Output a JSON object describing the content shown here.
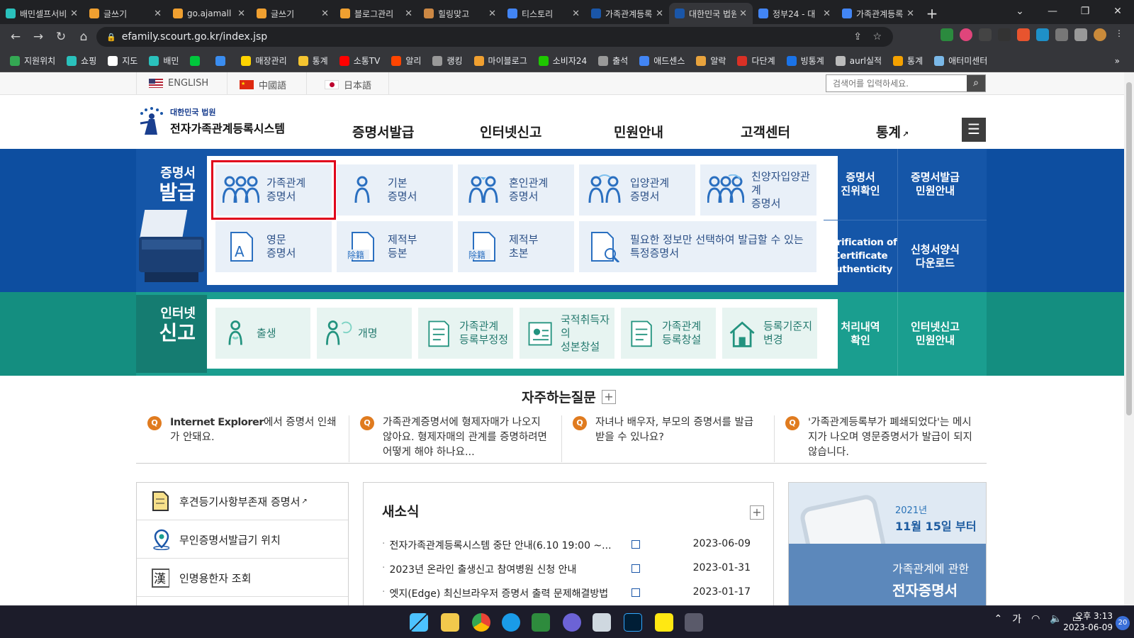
{
  "browser": {
    "tabs": [
      {
        "title": "배민셀프서비스",
        "color": "#2ac1bc"
      },
      {
        "title": "글쓰기",
        "color": "#f0a030"
      },
      {
        "title": "go.ajamall",
        "color": "#f0a030"
      },
      {
        "title": "글쓰기",
        "color": "#f0a030"
      },
      {
        "title": "블로그관리",
        "color": "#f0a030"
      },
      {
        "title": "힐링맞고",
        "color": "#cc8844"
      },
      {
        "title": "티스토리",
        "color": "#4285f4"
      },
      {
        "title": "가족관계등록",
        "color": "#1a56a8"
      },
      {
        "title": "대한민국 법원",
        "color": "#1a56a8",
        "active": true
      },
      {
        "title": "정부24 - 대",
        "color": "#4285f4"
      },
      {
        "title": "가족관계등록",
        "color": "#4285f4"
      }
    ],
    "url": "efamily.scourt.go.kr/index.jsp",
    "bookmarks": [
      {
        "label": "지원위치",
        "color": "#34a853"
      },
      {
        "label": "쇼핑",
        "color": "#2ac1bc"
      },
      {
        "label": "지도",
        "color": "#ffffff"
      },
      {
        "label": "배민",
        "color": "#2ac1bc"
      },
      {
        "label": "",
        "color": "#00c73c"
      },
      {
        "label": "",
        "color": "#3a8df0"
      },
      {
        "label": "매장관리",
        "color": "#ffd400"
      },
      {
        "label": "통계",
        "color": "#f4c430"
      },
      {
        "label": "소통TV",
        "color": "#ff0000"
      },
      {
        "label": "알리",
        "color": "#ff4500"
      },
      {
        "label": "랭킹",
        "color": "#999999"
      },
      {
        "label": "마이블로그",
        "color": "#f0a030"
      },
      {
        "label": "소비자24",
        "color": "#1ec800"
      },
      {
        "label": "출석",
        "color": "#999999"
      },
      {
        "label": "애드센스",
        "color": "#4285f4"
      },
      {
        "label": "알락",
        "color": "#e8a33d"
      },
      {
        "label": "다단계",
        "color": "#d93025"
      },
      {
        "label": "빙통계",
        "color": "#1a73e8"
      },
      {
        "label": "aurl실적",
        "color": "#bbbbbb"
      },
      {
        "label": "통계",
        "color": "#f4a100"
      },
      {
        "label": "애터미센터",
        "color": "#7ab8e8"
      }
    ]
  },
  "site": {
    "languages": [
      "ENGLISH",
      "中國語",
      "日本語"
    ],
    "search_placeholder": "검색어를 입력하세요.",
    "logo_line1": "대한민국 법원",
    "logo_line2": "전자가족관계등록시스템",
    "gnb": [
      "증명서발급",
      "인터넷신고",
      "민원안내",
      "고객센터",
      "통계"
    ],
    "cert_section": {
      "title1": "증명서",
      "title2": "발급",
      "cards": [
        {
          "l1": "가족관계",
          "l2": "증명서",
          "icon": "family-icon"
        },
        {
          "l1": "기본",
          "l2": "증명서",
          "icon": "person-icon"
        },
        {
          "l1": "혼인관계",
          "l2": "증명서",
          "icon": "couple-icon"
        },
        {
          "l1": "입양관계",
          "l2": "증명서",
          "icon": "adoption-icon"
        },
        {
          "l1": "친양자입양관계",
          "l2": "증명서",
          "icon": "adoption-family-icon"
        },
        {
          "l1": "영문",
          "l2": "증명서",
          "icon": "english-doc-icon"
        },
        {
          "l1": "제적부",
          "l2": "등본",
          "icon": "removed-doc-icon"
        },
        {
          "l1": "제적부",
          "l2": "초본",
          "icon": "removed-doc-icon"
        },
        {
          "l1": "필요한 정보만 선택하여 발급할 수 있는",
          "l2": "특정증명서",
          "icon": "search-doc-icon"
        }
      ],
      "stamp": "除籍",
      "side": [
        {
          "l1": "증명서",
          "l2": "진위확인"
        },
        {
          "l1": "증명서발급",
          "l2": "민원안내"
        },
        {
          "l1": "Verification of",
          "l2": "Certificate",
          "l3": "Authenticity"
        },
        {
          "l1": "신청서양식",
          "l2": "다운로드"
        }
      ]
    },
    "report_section": {
      "title1": "인터넷",
      "title2": "신고",
      "cards": [
        {
          "l1": "출생",
          "l2": "",
          "icon": "birth-icon"
        },
        {
          "l1": "개명",
          "l2": "",
          "icon": "rename-icon"
        },
        {
          "l1": "가족관계",
          "l2": "등록부정정",
          "icon": "correction-doc-icon"
        },
        {
          "l1": "국적취득자의",
          "l2": "성본창설",
          "icon": "id-card-icon"
        },
        {
          "l1": "가족관계",
          "l2": "등록창설",
          "icon": "create-doc-icon"
        },
        {
          "l1": "등록기준지",
          "l2": "변경",
          "icon": "house-icon"
        }
      ],
      "side": [
        {
          "l1": "처리내역",
          "l2": "확인"
        },
        {
          "l1": "인터넷신고",
          "l2": "민원안내"
        }
      ]
    },
    "faq": {
      "title": "자주하는질문",
      "q_mark": "Q",
      "items": [
        {
          "parts": [
            "Internet Explorer",
            "에서 증명서 인쇄가 안돼요."
          ]
        },
        {
          "parts": [
            "",
            "가족관계증명서에 형제자매가 나오지 않아요. 형제자매의 관계를 증명하려면 어떻게 해야 하나요..."
          ]
        },
        {
          "parts": [
            "",
            "자녀나 배우자, 부모의 증명서를 발급 받을 수 있나요?"
          ]
        },
        {
          "parts": [
            "",
            "'가족관계등록부가 폐쇄되었다'는 메시지가 나오며 영문증명서가 발급이 되지 않습니다."
          ]
        }
      ]
    },
    "quick_links": [
      {
        "label": "후견등기사항부존재 증명서",
        "icon": "document-icon",
        "external": true
      },
      {
        "label": "무인증명서발급기 위치",
        "icon": "location-pin-icon",
        "external": false
      },
      {
        "label": "인명용한자 조회",
        "icon": "hanja-book-icon",
        "external": false
      }
    ],
    "hanja_glyph": "漢",
    "news": {
      "title": "새소식",
      "items": [
        {
          "title": "전자가족관계등록시스템 중단 안내(6.10 19:00 ~...",
          "date": "2023-06-09"
        },
        {
          "title": "2023년 온라인 출생신고 참여병원 신청 안내",
          "date": "2023-01-31"
        },
        {
          "title": "엣지(Edge) 최신브라우저 증명서 출력 문제해결방법",
          "date": "2023-01-17"
        }
      ]
    },
    "banner": {
      "line1": "2021년",
      "line2": "11월 15일 부터",
      "line3": "가족관계에 관한",
      "line4": "전자증명서"
    }
  },
  "taskbar": {
    "ime": "가",
    "time": "오후 3:13",
    "date": "2023-06-09",
    "notifications": "20"
  },
  "colors": {
    "cert_blue": "#1556a8",
    "report_green": "#1a9e8f",
    "highlight": "#e0001b",
    "faq_orange": "#e07b1f"
  }
}
